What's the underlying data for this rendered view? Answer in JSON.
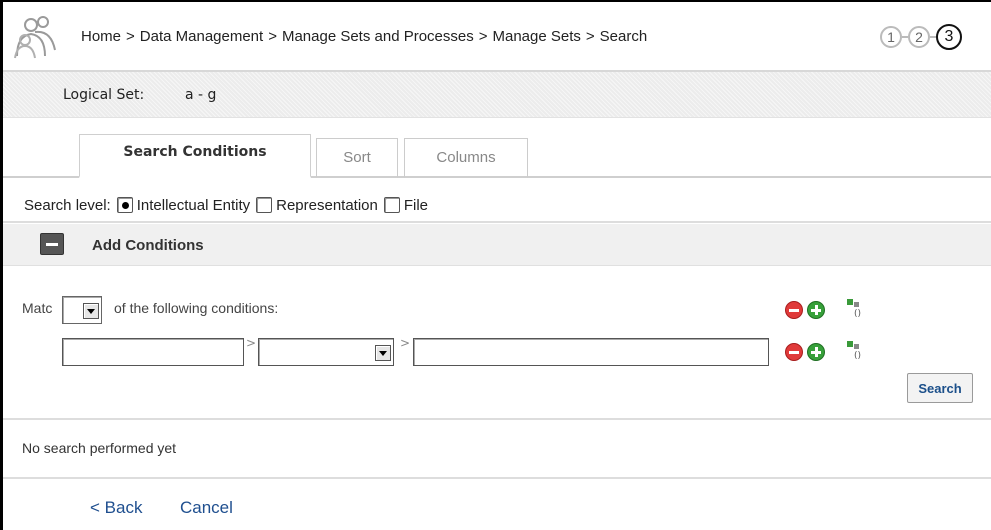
{
  "header": {
    "breadcrumb": [
      "Home",
      "Data Management",
      "Manage Sets and Processes",
      "Manage Sets",
      "Search"
    ],
    "separator": ">",
    "steps": [
      "1",
      "2",
      "3"
    ],
    "current_step": "3"
  },
  "logical_set": {
    "label": "Logical Set:",
    "value": "a - g"
  },
  "tabs": [
    {
      "label": "Search Conditions",
      "active": true
    },
    {
      "label": "Sort",
      "active": false
    },
    {
      "label": "Columns",
      "active": false
    }
  ],
  "search_level": {
    "label": "Search level:",
    "options": [
      {
        "label": "Intellectual Entity",
        "checked": true
      },
      {
        "label": "Representation",
        "checked": false
      },
      {
        "label": "File",
        "checked": false
      }
    ]
  },
  "add_conditions": {
    "label": "Add Conditions"
  },
  "match": {
    "prefix": "Matc",
    "suffix": "of the following conditions:",
    "selected": ""
  },
  "condition_row": {
    "field": "",
    "operator": "",
    "value": "",
    "separator": ">"
  },
  "actions": {
    "search_label": "Search"
  },
  "status": {
    "text": "No search performed yet"
  },
  "footer": {
    "back_label": "< Back",
    "cancel_label": "Cancel"
  },
  "colors": {
    "link": "#1f4f8f",
    "remove": "#e03a3a",
    "add": "#37a03a"
  }
}
